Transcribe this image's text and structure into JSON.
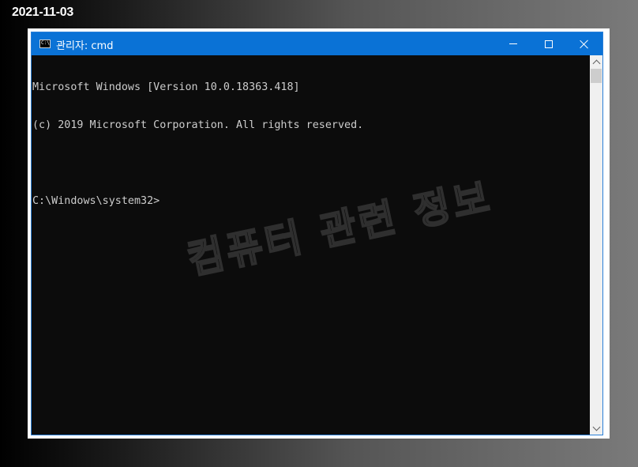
{
  "date_label": "2021-11-03",
  "window": {
    "title": "관리자: cmd",
    "icon_glyph": "C:\\",
    "icon_name": "cmd-icon",
    "controls": {
      "minimize_icon": "minimize-icon",
      "maximize_icon": "maximize-icon",
      "close_icon": "close-icon"
    }
  },
  "console": {
    "lines": [
      "Microsoft Windows [Version 10.0.18363.418]",
      "(c) 2019 Microsoft Corporation. All rights reserved.",
      "",
      "C:\\Windows\\system32>"
    ]
  },
  "watermark": "컴퓨터 관련 정보",
  "colors": {
    "titlebar": "#0a72d6",
    "console_bg": "#0c0c0c",
    "console_text": "#cccccc"
  }
}
